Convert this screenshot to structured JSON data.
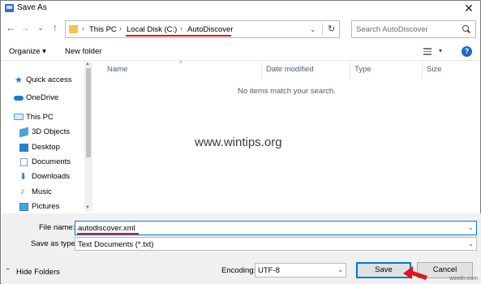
{
  "window": {
    "title": "Save As",
    "close_glyph": "✕",
    "icon": "save-dialog-icon"
  },
  "address": {
    "back_glyph": "←",
    "forward_glyph": "→",
    "recent_glyph": "⌄",
    "up_glyph": "↑",
    "separator_glyph": "›",
    "crumbs": [
      "This PC",
      "Local Disk (C:)",
      "AutoDiscover"
    ],
    "dropdown_glyph": "⌄",
    "refresh_glyph": "↻"
  },
  "search": {
    "placeholder": "Search AutoDiscover",
    "value": ""
  },
  "toolbar": {
    "organize_label": "Organize ▾",
    "new_folder_label": "New folder",
    "view_caret": "▾",
    "help_label": "?"
  },
  "nav": {
    "items": [
      {
        "label": "Quick access",
        "icon": "star-icon",
        "color": "#1e78d7"
      },
      {
        "label": "OneDrive",
        "icon": "cloud-icon",
        "color": "#1e78d7"
      },
      {
        "label": "This PC",
        "icon": "computer-icon",
        "color": "#4aa3df"
      },
      {
        "label": "3D Objects",
        "icon": "cube-icon",
        "color": "#4aa3df"
      },
      {
        "label": "Desktop",
        "icon": "desktop-icon",
        "color": "#2b7fd1"
      },
      {
        "label": "Documents",
        "icon": "document-icon",
        "color": "#8c9db0"
      },
      {
        "label": "Downloads",
        "icon": "download-icon",
        "color": "#2b7fd1"
      },
      {
        "label": "Music",
        "icon": "music-icon",
        "color": "#2b7fd1"
      },
      {
        "label": "Pictures",
        "icon": "pictures-icon",
        "color": "#4aa3df"
      }
    ]
  },
  "file_list": {
    "columns": [
      "Name",
      "Date modified",
      "Type",
      "Size"
    ],
    "sort_glyph": "^",
    "empty_message": "No items match your search."
  },
  "watermark": {
    "text": "www.wintips.org",
    "corner": "wsxdn.com"
  },
  "form": {
    "file_name_label": "File name:",
    "file_name_value": "autodiscover.xml",
    "save_as_type_label": "Save as type:",
    "save_as_type_value": "Text Documents (*.txt)",
    "encoding_label": "Encoding:",
    "encoding_value": "UTF-8",
    "caret": "⌄"
  },
  "footer": {
    "hide_folders_label": "Hide Folders",
    "hide_folders_glyph": "⌃",
    "save_label": "Save",
    "cancel_label": "Cancel"
  },
  "colors": {
    "accent": "#0078d7",
    "annotation_red": "#e0141e",
    "folder_yellow": "#f4c44e"
  }
}
